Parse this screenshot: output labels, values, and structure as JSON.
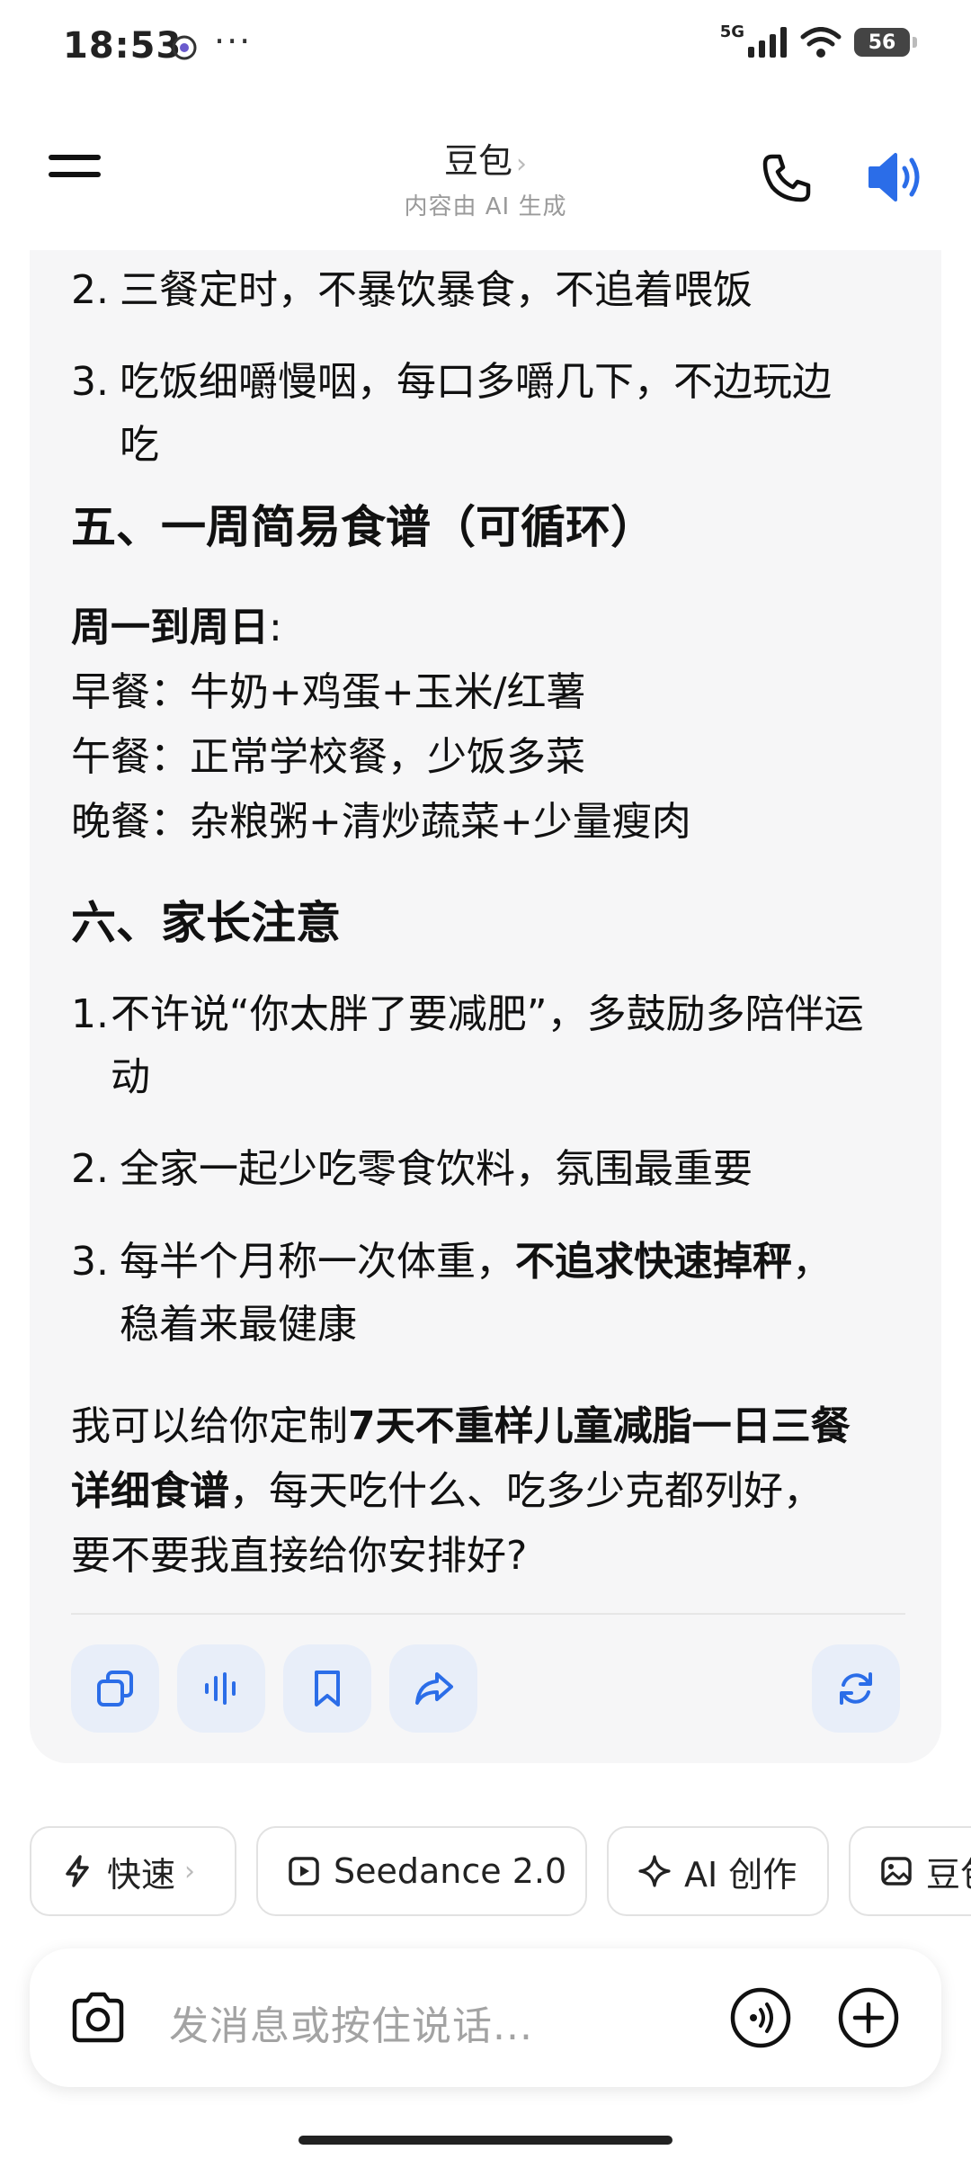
{
  "status": {
    "time": "18:53",
    "dots": "···",
    "network": "5G",
    "battery": "56"
  },
  "header": {
    "title": "豆包",
    "title_chevron": "›",
    "subtitle": "内容由 AI 生成"
  },
  "message": {
    "list_a": [
      {
        "num": "2.",
        "text": "三餐定时，不暴饮暴食，不追着喂饭"
      },
      {
        "num": "3.",
        "text_l1": "吃饭细嚼慢咽，每口多嚼几下，不边玩边",
        "text_l2": "吃"
      }
    ],
    "heading5": "五、一周简易食谱（可循环）",
    "week_label": "周一到周日",
    "week_colon": ":",
    "meals": [
      "早餐：牛奶+鸡蛋+玉米/红薯",
      "午餐：正常学校餐，少饭多菜",
      "晚餐：杂粮粥+清炒蔬菜+少量瘦肉"
    ],
    "heading6": "六、家长注意",
    "list_b": [
      {
        "num": "1.",
        "text_l1": "不许说“你太胖了要减肥”，多鼓励多陪伴运",
        "text_l2": "动"
      },
      {
        "num": "2.",
        "text": "全家一起少吃零食饮料，氛围最重要"
      },
      {
        "num": "3.",
        "text_pre": "每半个月称一次体重，",
        "text_bold": "不追求快速掉秤",
        "text_post": "，",
        "text_l2": "稳着来最健康"
      }
    ],
    "closing": {
      "pre": "我可以给你定制",
      "bold_l1": "7天不重样儿童减脂一日三餐",
      "bold_l2": "详细食谱",
      "post_l2": "，每天吃什么、吃多少克都列好，",
      "l3": "要不要我直接给你安排好?"
    }
  },
  "chips": [
    {
      "label": "快速",
      "chevron": "›",
      "icon": "lightning-icon"
    },
    {
      "label": "Seedance 2.0",
      "icon": "play-icon"
    },
    {
      "label": "AI 创作",
      "icon": "sparkle-icon"
    },
    {
      "label": "豆包",
      "icon": "image-icon"
    }
  ],
  "input": {
    "placeholder": "发消息或按住说话..."
  },
  "colors": {
    "accent": "#2b6de8",
    "action_bg": "#e8eef9",
    "card_bg": "#f6f6f7"
  }
}
